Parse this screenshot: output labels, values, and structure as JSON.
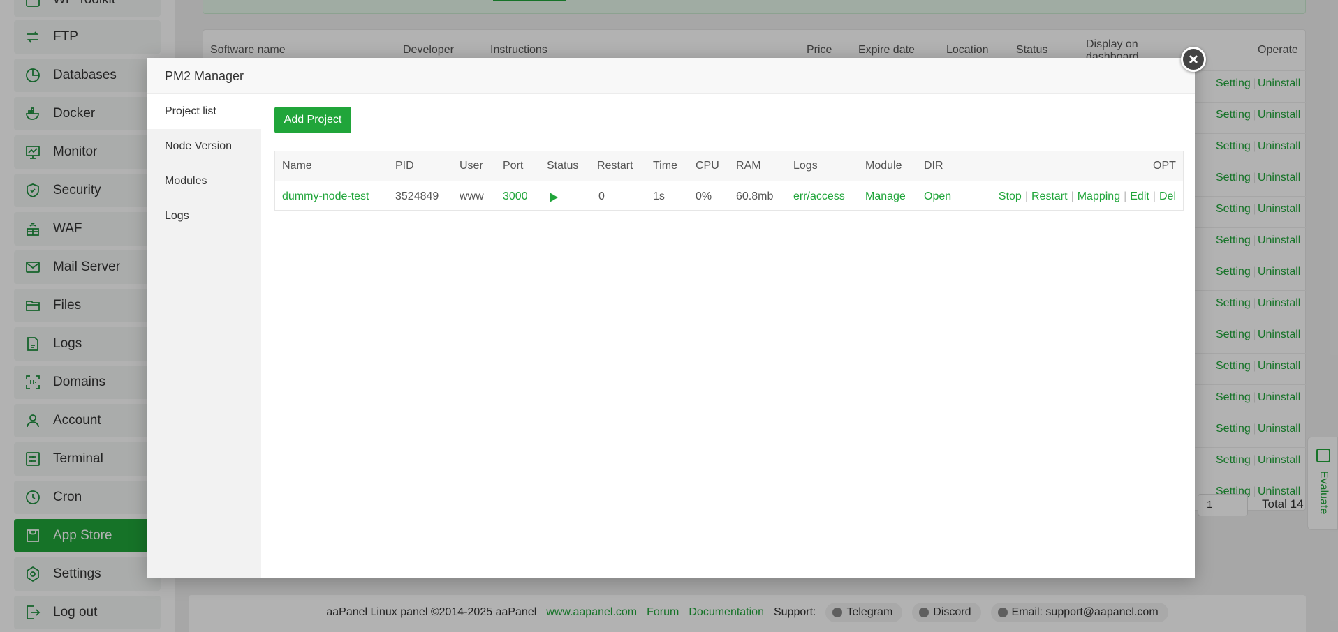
{
  "sidebar": {
    "items": [
      {
        "label": "WP Toolkit",
        "icon": "wp-toolkit-icon"
      },
      {
        "label": "FTP",
        "icon": "ftp-icon"
      },
      {
        "label": "Databases",
        "icon": "database-icon"
      },
      {
        "label": "Docker",
        "icon": "docker-icon"
      },
      {
        "label": "Monitor",
        "icon": "monitor-icon"
      },
      {
        "label": "Security",
        "icon": "shield-icon"
      },
      {
        "label": "WAF",
        "icon": "waf-icon"
      },
      {
        "label": "Mail Server",
        "icon": "mail-icon"
      },
      {
        "label": "Files",
        "icon": "folder-icon"
      },
      {
        "label": "Logs",
        "icon": "logs-icon"
      },
      {
        "label": "Domains",
        "icon": "domains-icon"
      },
      {
        "label": "Account",
        "icon": "user-icon"
      },
      {
        "label": "Terminal",
        "icon": "terminal-icon"
      },
      {
        "label": "Cron",
        "icon": "clock-icon"
      },
      {
        "label": "App Store",
        "icon": "store-icon"
      },
      {
        "label": "Settings",
        "icon": "gear-icon"
      },
      {
        "label": "Log out",
        "icon": "logout-icon"
      }
    ]
  },
  "app_table": {
    "headers": [
      "Software name",
      "Developer",
      "Instructions",
      "Price",
      "Expire date",
      "Location",
      "Status",
      "Display on dashboard",
      "Operate"
    ],
    "row_ops": {
      "setting": "Setting",
      "uninstall": "Uninstall"
    },
    "row_count": 14,
    "pager_value": "1",
    "total": "Total 14"
  },
  "footer": {
    "copyright": "aaPanel Linux panel ©2014-2025 aaPanel",
    "site": "www.aapanel.com",
    "forum": "Forum",
    "docs": "Documentation",
    "support": "Support:",
    "telegram": "Telegram",
    "discord": "Discord",
    "email": "Email: support@aapanel.com"
  },
  "evaluate": "Evaluate",
  "modal": {
    "title": "PM2 Manager",
    "tabs": [
      "Project list",
      "Node Version",
      "Modules",
      "Logs"
    ],
    "add_button": "Add Project",
    "columns": [
      "Name",
      "PID",
      "User",
      "Port",
      "Status",
      "Restart",
      "Time",
      "CPU",
      "RAM",
      "Logs",
      "Module",
      "DIR",
      "OPT"
    ],
    "row": {
      "name": "dummy-node-test",
      "pid": "3524849",
      "user": "www",
      "port": "3000",
      "status": "running",
      "restart": "0",
      "time": "1s",
      "cpu": "0%",
      "ram": "60.8mb",
      "logs": "err/access",
      "module": "Manage",
      "dir": "Open",
      "ops": [
        "Stop",
        "Restart",
        "Mapping",
        "Edit",
        "Del"
      ]
    }
  },
  "colors": {
    "accent": "#20a53a"
  }
}
